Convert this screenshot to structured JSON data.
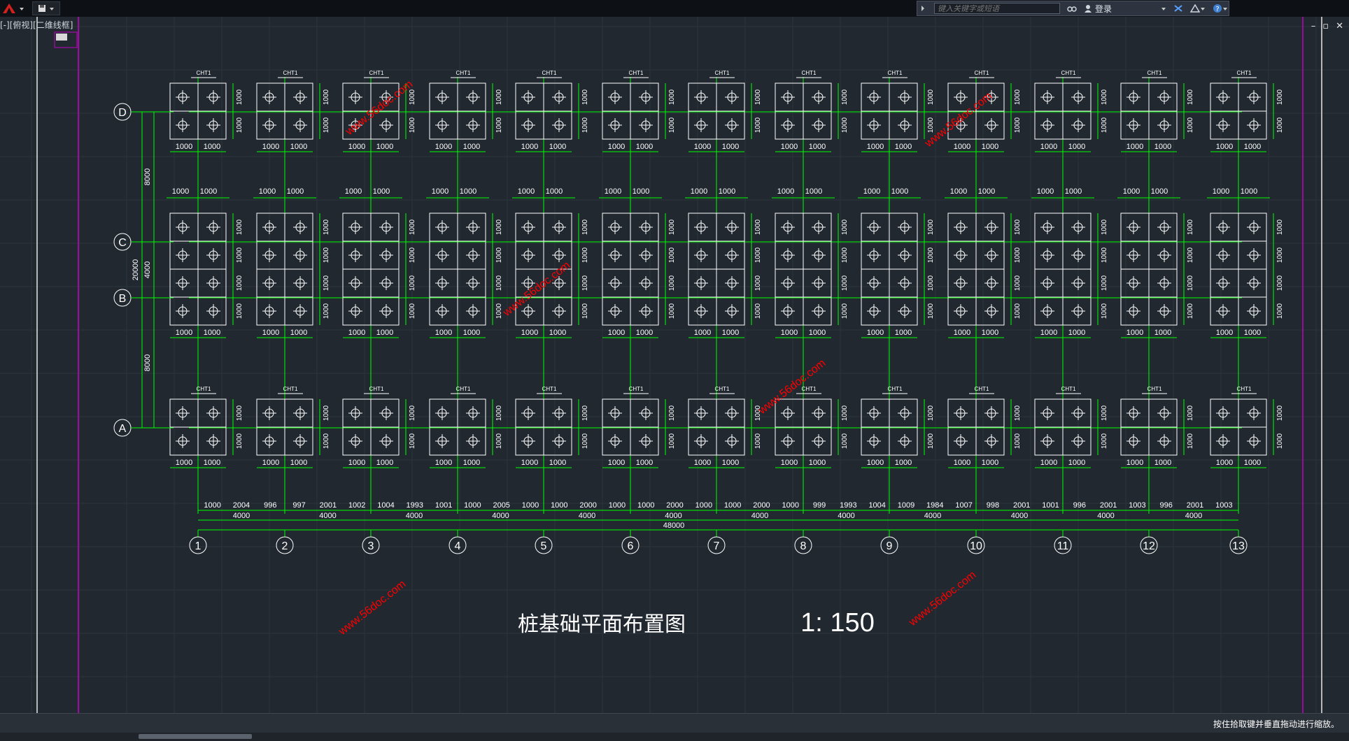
{
  "app": {
    "quick_access": {
      "icon": "save-icon"
    },
    "search_placeholder": "键入关键字或短语",
    "login_label": "登录",
    "layout_tab": "[-][俯视][二维线框]",
    "status_message": "按住拾取键并垂直拖动进行缩放。"
  },
  "icons": {
    "app_menu": "autocad-logo-icon",
    "binoculars": "binoculars-icon",
    "user": "user-icon",
    "exchange": "exchange-icon",
    "app_store": "a360-icon",
    "help": "help-icon"
  },
  "colors": {
    "canvas": "#212830",
    "dimension": "#00ff00",
    "geometry": "#ffffff",
    "watermark": "#ff0000",
    "frame_magenta": "#c400c4"
  },
  "drawing": {
    "title": "桩基础平面布置图",
    "scale": "1: 150",
    "axes_rows": [
      "D",
      "C",
      "B",
      "A"
    ],
    "axes_columns": [
      "1",
      "2",
      "3",
      "4",
      "5",
      "6",
      "7",
      "8",
      "9",
      "10",
      "11",
      "12",
      "13"
    ],
    "cap_label": "CHT1",
    "cap_dim": "1000",
    "row_spacing_labels": [
      "8000",
      "4000",
      "8000"
    ],
    "total_height_label": "20000",
    "bay_dims_top": [
      "1000",
      "2004",
      "996",
      "997",
      "2001",
      "1002",
      "1004",
      "1993",
      "1001",
      "1000",
      "2005",
      "1000",
      "1000",
      "2000",
      "1000",
      "1000",
      "2000",
      "1000",
      "1000",
      "2000",
      "1000",
      "999",
      "1993",
      "1004",
      "1009",
      "1984",
      "1007",
      "998",
      "2001",
      "1001",
      "996",
      "2001",
      "1003",
      "996",
      "2001",
      "1003"
    ],
    "bay_dims_mid": [
      "4000",
      "4000",
      "4000",
      "4000",
      "4000",
      "4000",
      "4000",
      "4000",
      "4000",
      "4000",
      "4000",
      "4000"
    ],
    "overall_length": "48000",
    "watermark": "www.56doc.com"
  }
}
